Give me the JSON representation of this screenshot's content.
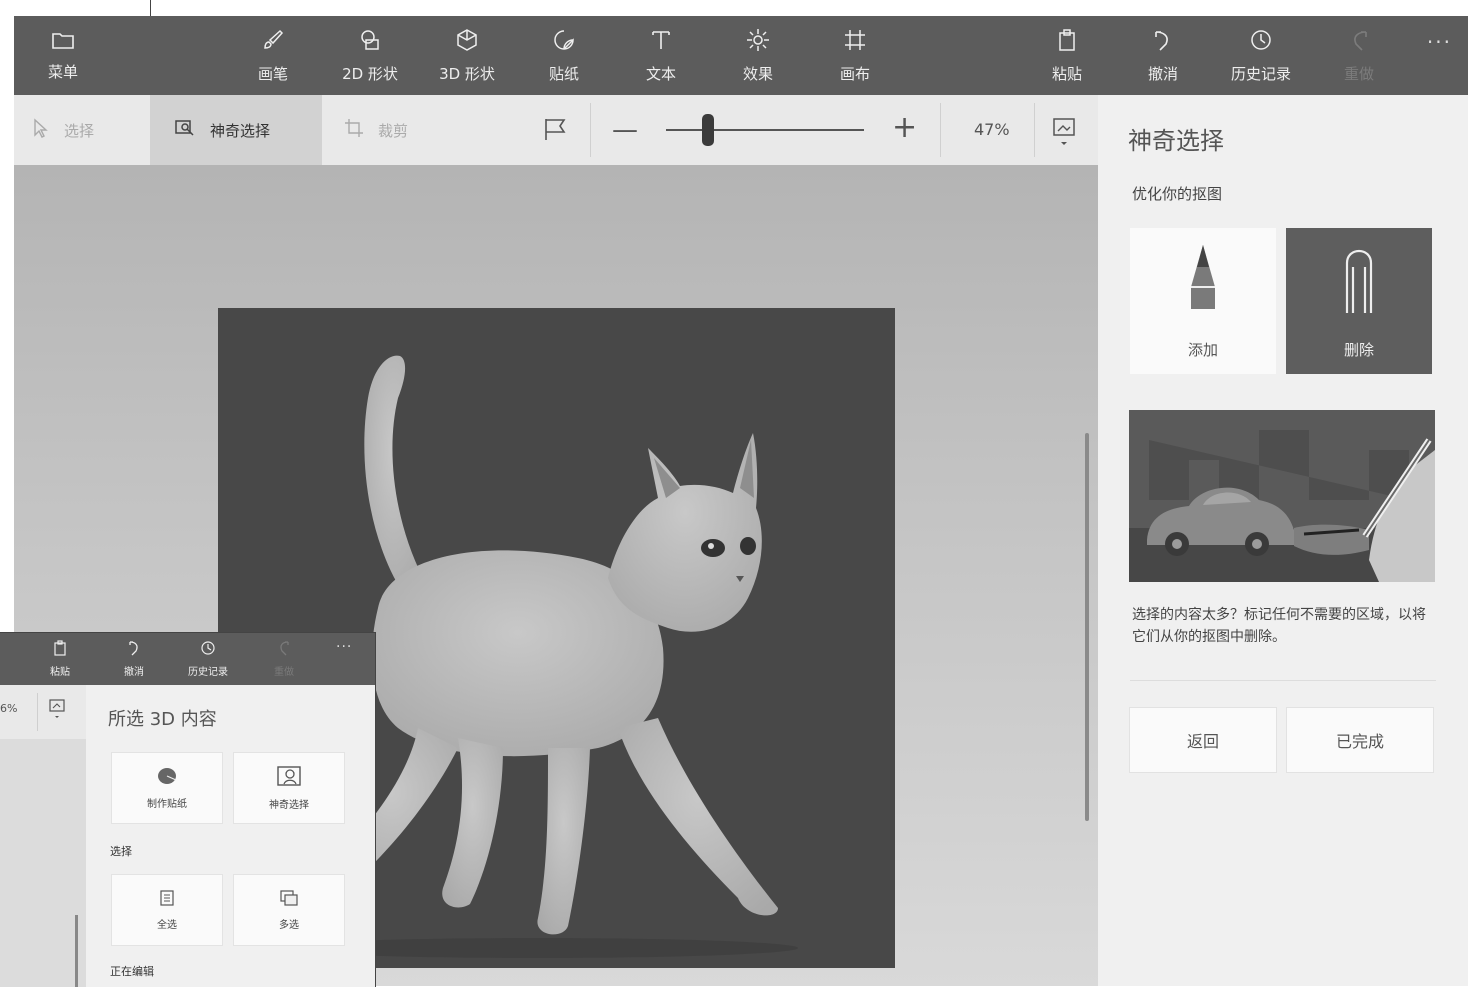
{
  "toolbar": {
    "menu": {
      "label": "菜单",
      "icon": "folder-icon"
    },
    "items": [
      {
        "label": "画笔",
        "icon": "brush-icon"
      },
      {
        "label": "2D 形状",
        "icon": "shapes-2d-icon"
      },
      {
        "label": "3D 形状",
        "icon": "cube-icon"
      },
      {
        "label": "贴纸",
        "icon": "sticker-icon"
      },
      {
        "label": "文本",
        "icon": "text-icon"
      },
      {
        "label": "效果",
        "icon": "effects-icon"
      },
      {
        "label": "画布",
        "icon": "canvas-icon"
      }
    ],
    "paste": "粘贴",
    "undo": "撤消",
    "history": "历史记录",
    "redo": "重做",
    "more": "···"
  },
  "subtoolbar": {
    "select": "选择",
    "magic_select": "神奇选择",
    "crop": "裁剪",
    "zoom": "47%"
  },
  "panel": {
    "title": "神奇选择",
    "subtitle": "优化你的抠图",
    "add": "添加",
    "remove": "删除",
    "description": "选择的内容太多？标记任何不需要的区域，以将它们从你的抠图中删除。",
    "back": "返回",
    "done": "已完成"
  },
  "overlay": {
    "paste": "粘贴",
    "undo": "撤消",
    "history": "历史记录",
    "redo": "重做",
    "more": "···",
    "zoom": "6%",
    "title": "所选 3D 内容",
    "make_sticker": "制作贴纸",
    "magic_select": "神奇选择",
    "section_select": "选择",
    "whole": "全选",
    "multi": "多选",
    "section_edit": "正在编辑"
  },
  "colors": {
    "toolbar_bg": "#5c5c5c",
    "panel_bg": "#f0f0f0",
    "accent_selected": "#5e5e5e"
  }
}
